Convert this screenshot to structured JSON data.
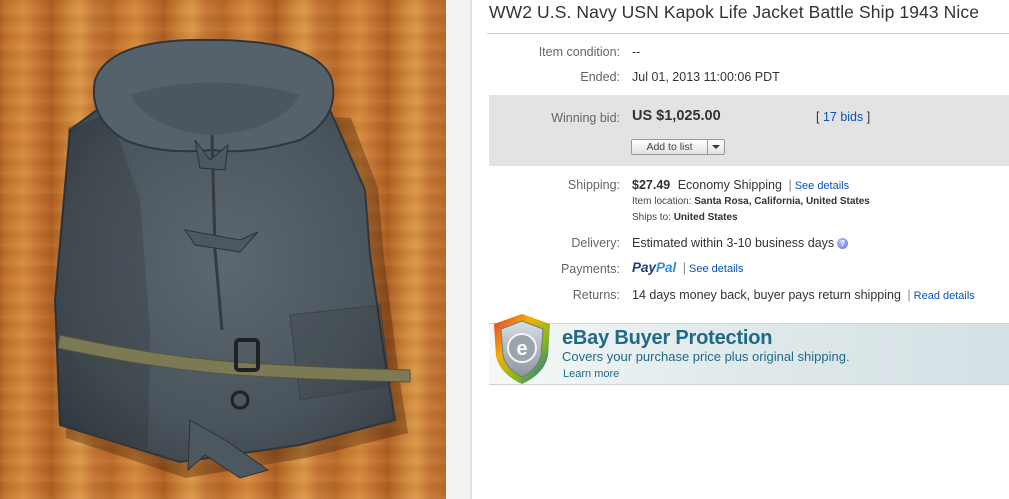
{
  "listing": {
    "title": "WW2 U.S. Navy USN Kapok Life Jacket Battle Ship 1943 Nice",
    "condition_label": "Item condition:",
    "condition_value": "--",
    "ended_label": "Ended:",
    "ended_value": "Jul 01, 2013  11:00:06 PDT",
    "winning_bid_label": "Winning bid:",
    "winning_bid_value": "US $1,025.00",
    "bids_open": "[ ",
    "bids_link": "17 bids",
    "bids_close": " ]",
    "add_to_list_label": "Add to list",
    "shipping_label": "Shipping:",
    "shipping_price": "$27.49",
    "shipping_method": "Economy Shipping",
    "shipping_sep": "|",
    "shipping_details_link": "See details",
    "item_location_label": "Item location:",
    "item_location_value": "Santa Rosa, California, United States",
    "ships_to_label": "Ships to:",
    "ships_to_value": "United States",
    "delivery_label": "Delivery:",
    "delivery_value": "Estimated within 3-10 business days",
    "help_icon_glyph": "?",
    "payments_label": "Payments:",
    "paypal_pay": "Pay",
    "paypal_pal": "Pal",
    "payments_sep": "|",
    "payments_details_link": "See details",
    "returns_label": "Returns:",
    "returns_value": "14 days money back, buyer pays return shipping",
    "returns_sep": "|",
    "returns_link": "Read details"
  },
  "protection": {
    "title": "eBay Buyer Protection",
    "text": "Covers your purchase price plus original shipping.",
    "learn_more": "Learn more",
    "shield_letter": "e"
  },
  "photo": {
    "icon": "product-photo-life-jacket"
  },
  "colors": {
    "link": "#0654ba",
    "bid_box": "#e3e3e3",
    "protection_text": "#1f6a86",
    "paypal_dark": "#233a7d",
    "paypal_light": "#2d8fd7"
  }
}
